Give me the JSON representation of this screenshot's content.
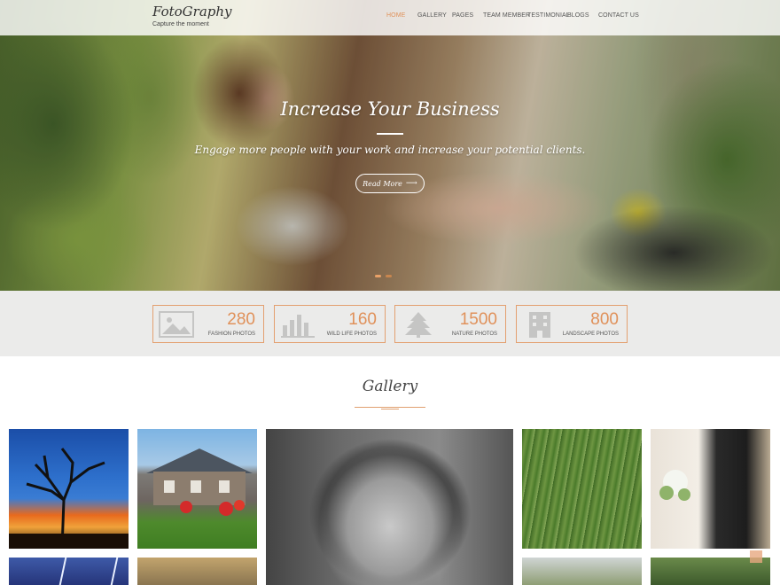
{
  "brand": {
    "title": "FotoGraphy",
    "tagline": "Capture the moment"
  },
  "nav": {
    "items": [
      {
        "label": "HOME",
        "active": true
      },
      {
        "label": "GALLERY",
        "active": false
      },
      {
        "label": "PAGES",
        "active": false
      },
      {
        "label": "TEAM MEMBER",
        "active": false
      },
      {
        "label": "TESTIMONIAL",
        "active": false
      },
      {
        "label": "BLOGS",
        "active": false
      },
      {
        "label": "CONTACT US",
        "active": false
      }
    ]
  },
  "hero": {
    "title": "Increase Your Business",
    "subtitle": "Engage more people with your work and increase your potential clients.",
    "button_label": "Read More",
    "button_icon": "arrow-right-icon",
    "slide_count": 2
  },
  "stats": [
    {
      "value": "280",
      "label": "FASHION PHOTOS",
      "icon": "image-icon"
    },
    {
      "value": "160",
      "label": "WILD LIFE PHOTOS",
      "icon": "bar-chart-icon"
    },
    {
      "value": "1500",
      "label": "NATURE PHOTOS",
      "icon": "tree-icon"
    },
    {
      "value": "800",
      "label": "LANDSCAPE PHOTOS",
      "icon": "building-icon"
    }
  ],
  "gallery": {
    "title": "Gallery",
    "tiles": [
      "sunset-tree",
      "stone-house",
      "portrait-bw",
      "wheat-field",
      "wedding",
      "lightning-storm",
      "dirt-road",
      "hills",
      "couple"
    ]
  },
  "colors": {
    "accent": "#e0915a",
    "stat_border": "#e3a070",
    "stats_bg": "#ebebea",
    "header_bg": "#ffffff"
  }
}
